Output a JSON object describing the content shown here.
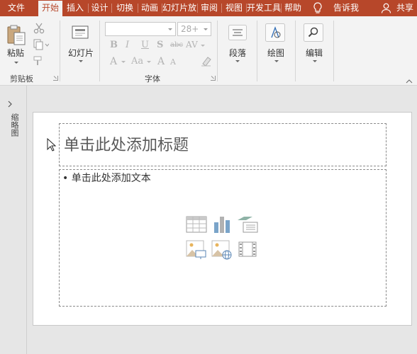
{
  "tabs": {
    "file": "文件",
    "home": "开始",
    "insert": "插入",
    "design": "设计",
    "transitions": "切换",
    "animations": "动画",
    "slideshow": "幻灯片放",
    "review": "审阅",
    "view": "视图",
    "developer": "开发工具",
    "help": "帮助",
    "tellme": "告诉我",
    "share": "共享"
  },
  "ribbon": {
    "clipboard": {
      "paste_label": "粘贴",
      "group_label": "剪贴板"
    },
    "slides": {
      "new_slide_label": "幻灯片"
    },
    "font": {
      "font_name_value": "",
      "font_size_value": "28+",
      "bold": "B",
      "italic": "I",
      "underline": "U",
      "shadow": "S",
      "strikethrough": "abc",
      "spacing": "AV",
      "grow": "A",
      "shrink": "A",
      "case": "Aa",
      "group_label": "字体"
    },
    "paragraph": {
      "label": "段落"
    },
    "drawing": {
      "label": "绘图"
    },
    "editing": {
      "label": "编辑"
    }
  },
  "left_pane": {
    "label": "缩略图"
  },
  "slide": {
    "title_placeholder": "单击此处添加标题",
    "body_placeholder": "• 单击此处添加文本"
  },
  "colors": {
    "accent": "#b7472a",
    "ribbon_bg": "#f3f3f3",
    "workspace_bg": "#e6e6e6"
  }
}
